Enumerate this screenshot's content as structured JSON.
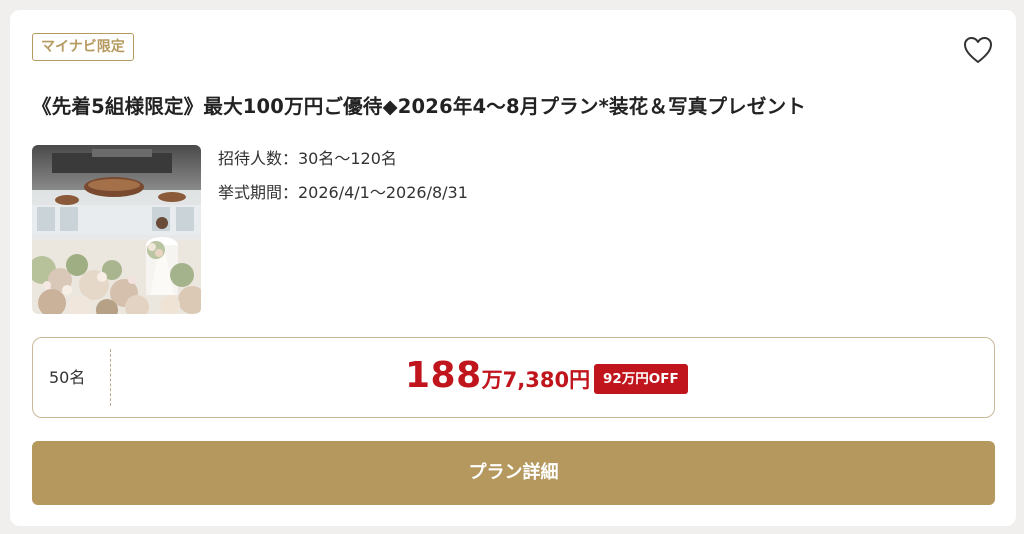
{
  "card": {
    "badge": "マイナビ限定",
    "favorite_icon": "heart-outline-icon",
    "title": "《先着5組様限定》最大100万円ご優待◆2026年4～8月プラン*装花＆写真プレゼント",
    "info": {
      "guests_range": "招待人数：30名～120名",
      "ceremony_period": "挙式期間：2026/4/1～2026/8/31"
    },
    "price": {
      "guests": "50名",
      "amount_big": "188",
      "amount_unit": "万",
      "amount_small": "7,380円",
      "discount": "92万円OFF"
    },
    "detail_button": "プラン詳細"
  },
  "colors": {
    "accent_gold": "#b5985d",
    "price_red": "#c0151c",
    "badge_text": "#b59a5f"
  }
}
